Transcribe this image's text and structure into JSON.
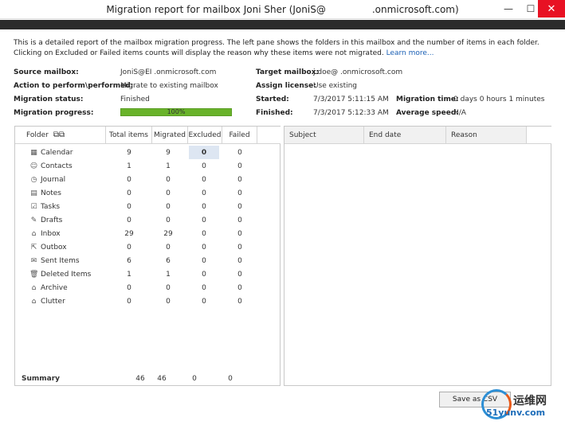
{
  "window": {
    "title": "Migration report for mailbox Joni Sher (JoniS@",
    "title_suffix": ".onmicrosoft.com)",
    "min_glyph": "—",
    "max_glyph": "☐",
    "close_glyph": "✕"
  },
  "description": {
    "text": "This is a detailed report of the mailbox migration progress. The left pane shows the folders in this mailbox and the number of items in each folder. Clicking on Excluded or Failed items counts will display the reason why these items were not migrated.",
    "link": "Learn more..."
  },
  "details": {
    "source_mailbox_label": "Source mailbox:",
    "source_mailbox_value": "JoniS@EI            .onmicrosoft.com",
    "action_label": "Action to perform\\performed:",
    "action_value": "Migrate to existing mailbox",
    "status_label": "Migration status:",
    "status_value": "Finished",
    "progress_label": "Migration progress:",
    "progress_value": "100%",
    "progress_fraction": 1.0,
    "target_mailbox_label": "Target mailbox:",
    "target_mailbox_value": "j.doe@            .onmicrosoft.com",
    "assign_license_label": "Assign license:",
    "assign_license_value": "Use existing",
    "started_label": "Started:",
    "started_value": "7/3/2017 5:11:15 AM",
    "finished_label": "Finished:",
    "finished_value": "7/3/2017 5:12:33 AM",
    "migration_time_label": "Migration time:",
    "migration_time_value": "0 days 0 hours 1 minutes",
    "average_speed_label": "Average speed:",
    "average_speed_value": "N/A"
  },
  "folders_table": {
    "headers": {
      "folder": "Folder",
      "total": "Total items",
      "migrated": "Migrated",
      "excluded": "Excluded",
      "failed": "Failed"
    },
    "rows": [
      {
        "name": "Calendar",
        "icon": "calendar-icon",
        "glyph": "▦",
        "total": "9",
        "migrated": "9",
        "excluded": "0",
        "failed": "0"
      },
      {
        "name": "Contacts",
        "icon": "contacts-icon",
        "glyph": "☺",
        "total": "1",
        "migrated": "1",
        "excluded": "0",
        "failed": "0"
      },
      {
        "name": "Journal",
        "icon": "journal-icon",
        "glyph": "◷",
        "total": "0",
        "migrated": "0",
        "excluded": "0",
        "failed": "0"
      },
      {
        "name": "Notes",
        "icon": "notes-icon",
        "glyph": "▤",
        "total": "0",
        "migrated": "0",
        "excluded": "0",
        "failed": "0"
      },
      {
        "name": "Tasks",
        "icon": "tasks-icon",
        "glyph": "☑",
        "total": "0",
        "migrated": "0",
        "excluded": "0",
        "failed": "0"
      },
      {
        "name": "Drafts",
        "icon": "drafts-icon",
        "glyph": "✎",
        "total": "0",
        "migrated": "0",
        "excluded": "0",
        "failed": "0"
      },
      {
        "name": "Inbox",
        "icon": "inbox-icon",
        "glyph": "⌂",
        "total": "29",
        "migrated": "29",
        "excluded": "0",
        "failed": "0"
      },
      {
        "name": "Outbox",
        "icon": "outbox-icon",
        "glyph": "⇱",
        "total": "0",
        "migrated": "0",
        "excluded": "0",
        "failed": "0"
      },
      {
        "name": "Sent Items",
        "icon": "sent-items-icon",
        "glyph": "✉",
        "total": "6",
        "migrated": "6",
        "excluded": "0",
        "failed": "0"
      },
      {
        "name": "Deleted Items",
        "icon": "deleted-items-icon",
        "glyph": "🗑",
        "total": "1",
        "migrated": "1",
        "excluded": "0",
        "failed": "0"
      },
      {
        "name": "Archive",
        "icon": "archive-icon",
        "glyph": "⌂",
        "total": "0",
        "migrated": "0",
        "excluded": "0",
        "failed": "0"
      },
      {
        "name": "Clutter",
        "icon": "clutter-icon",
        "glyph": "⌂",
        "total": "0",
        "migrated": "0",
        "excluded": "0",
        "failed": "0"
      }
    ],
    "summary": {
      "label": "Summary",
      "total": "46",
      "migrated": "46",
      "excluded": "0",
      "failed": "0"
    }
  },
  "reason_table": {
    "headers": {
      "subject": "Subject",
      "end_date": "End date",
      "reason": "Reason"
    }
  },
  "buttons": {
    "save_csv": "Save as CSV"
  },
  "watermark": {
    "brand_cn": "运维网",
    "url": "51yunv.com"
  },
  "colors": {
    "progress": "#69b32a",
    "close": "#e81123",
    "link": "#1a5fb4",
    "band": "#2b2b2b"
  }
}
